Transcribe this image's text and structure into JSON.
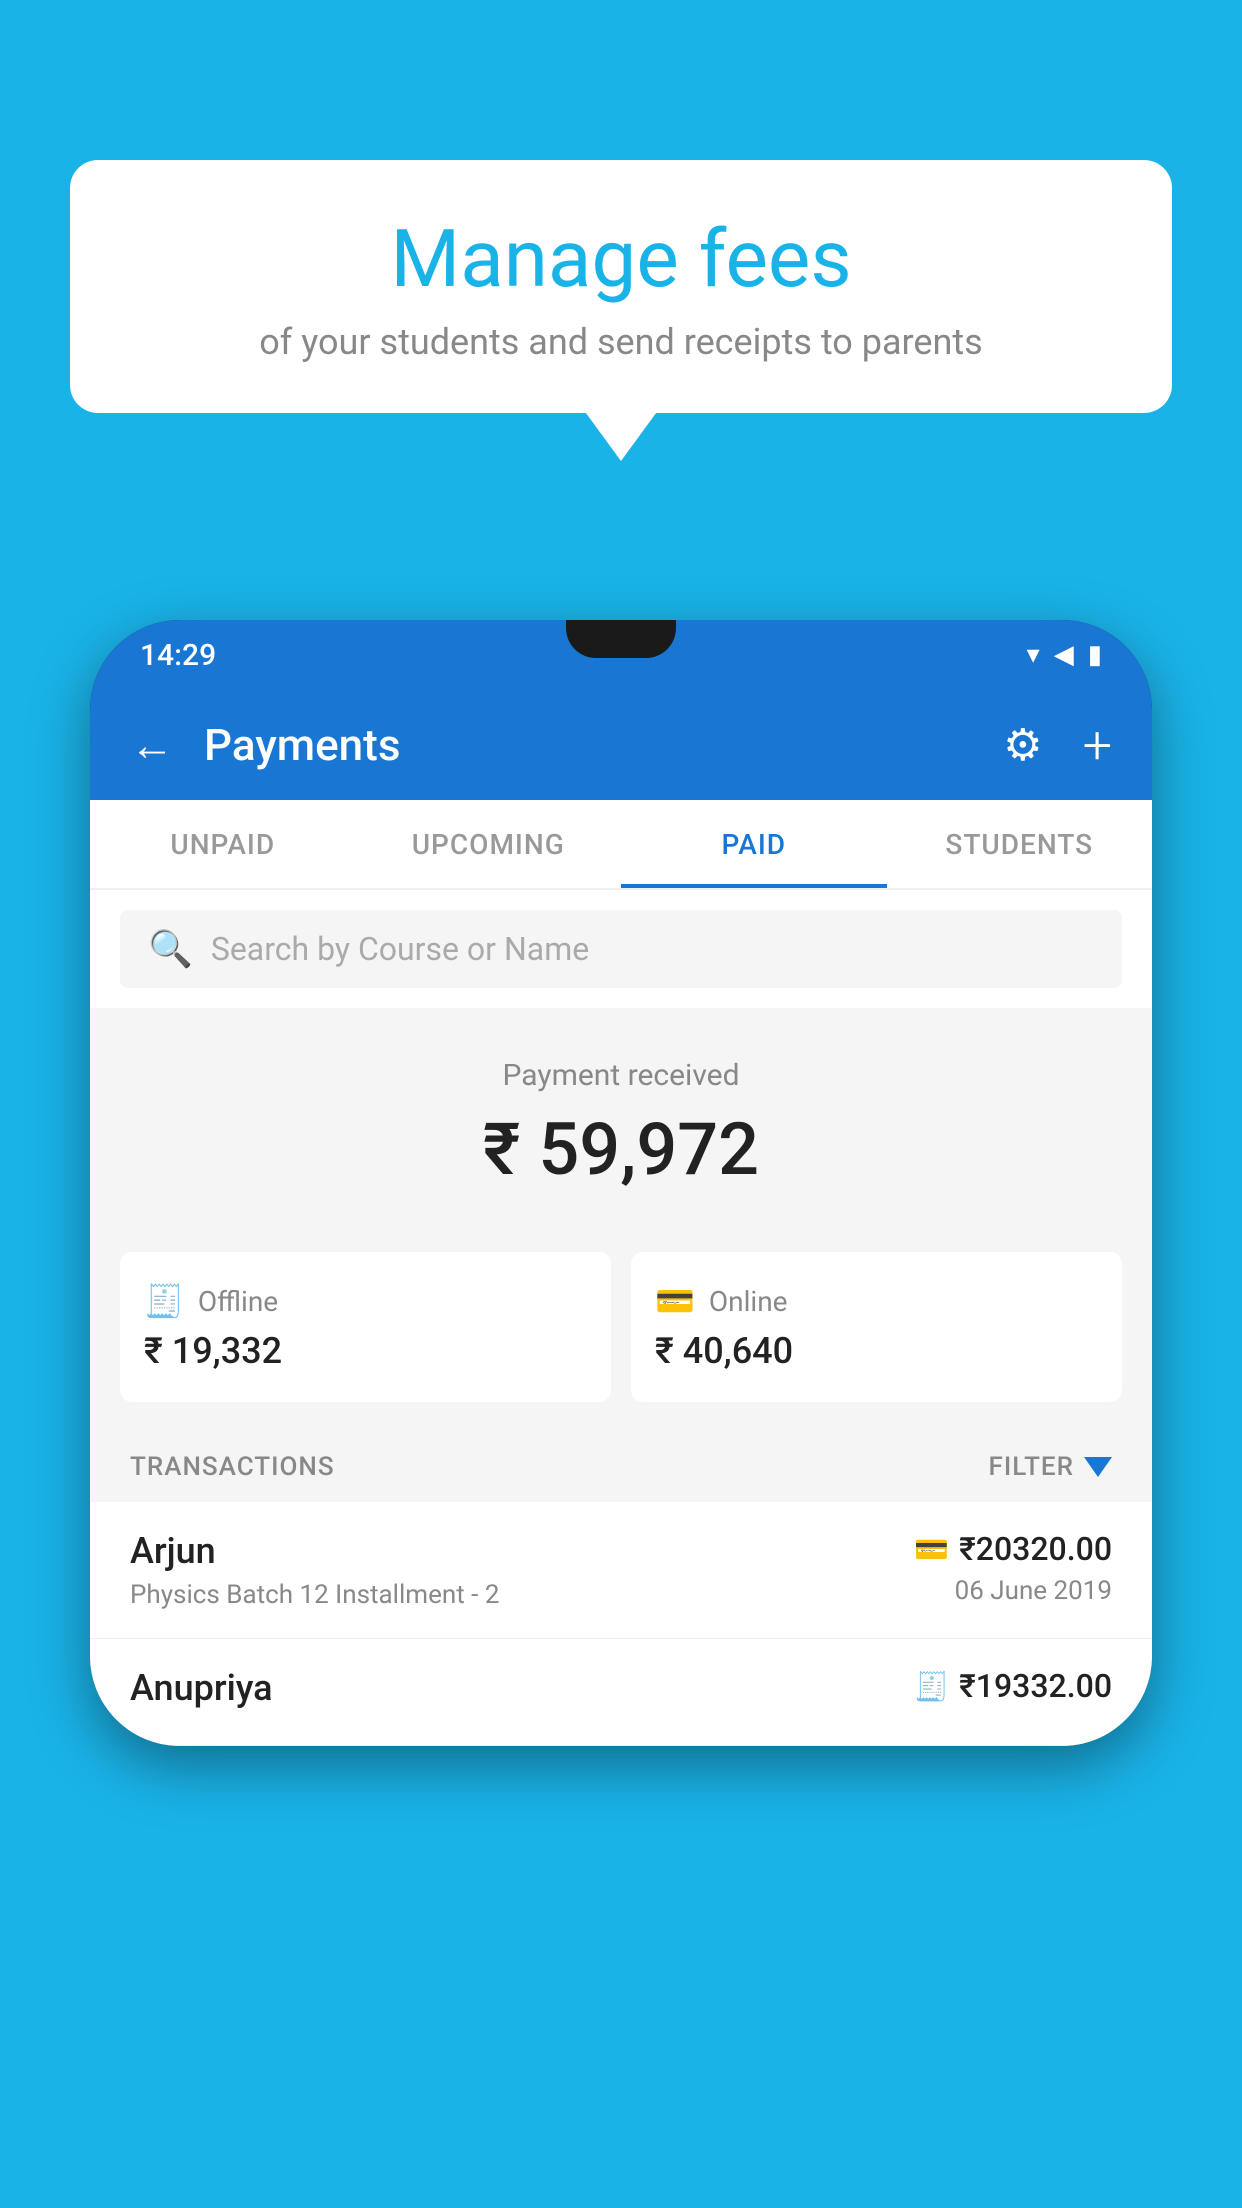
{
  "background_color": "#1ab3e8",
  "speech_bubble": {
    "title": "Manage fees",
    "subtitle": "of your students and send receipts to parents"
  },
  "status_bar": {
    "time": "14:29"
  },
  "app_bar": {
    "title": "Payments",
    "back_label": "←",
    "gear_label": "⚙",
    "plus_label": "+"
  },
  "tabs": [
    {
      "label": "UNPAID",
      "active": false
    },
    {
      "label": "UPCOMING",
      "active": false
    },
    {
      "label": "PAID",
      "active": true
    },
    {
      "label": "STUDENTS",
      "active": false
    }
  ],
  "search": {
    "placeholder": "Search by Course or Name"
  },
  "payment_summary": {
    "label": "Payment received",
    "amount": "₹ 59,972",
    "offline_label": "Offline",
    "offline_amount": "₹ 19,332",
    "online_label": "Online",
    "online_amount": "₹ 40,640"
  },
  "transactions_section": {
    "label": "TRANSACTIONS",
    "filter_label": "FILTER"
  },
  "transactions": [
    {
      "name": "Arjun",
      "detail": "Physics Batch 12 Installment - 2",
      "amount": "₹20320.00",
      "date": "06 June 2019",
      "payment_type": "card"
    },
    {
      "name": "Anupriya",
      "detail": "",
      "amount": "₹19332.00",
      "date": "",
      "payment_type": "offline"
    }
  ]
}
